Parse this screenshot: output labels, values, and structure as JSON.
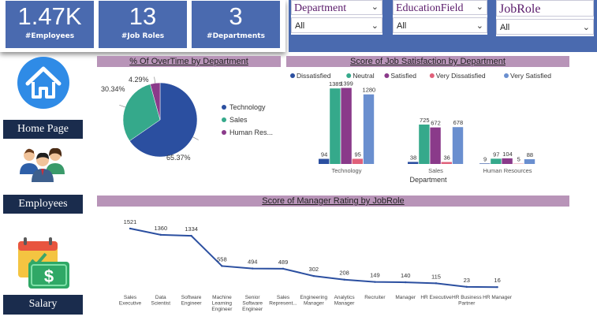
{
  "kpis": [
    {
      "value": "1.47K",
      "label": "#Employees"
    },
    {
      "value": "13",
      "label": "#Job Roles"
    },
    {
      "value": "3",
      "label": "#Departments"
    }
  ],
  "filters": [
    {
      "title": "Department",
      "value": "All"
    },
    {
      "title": "EducationField",
      "value": "All"
    },
    {
      "title": "JobRole",
      "value": "All"
    }
  ],
  "nav": {
    "home": "Home Page",
    "employees": "Employees",
    "salary": "Salary"
  },
  "colors": {
    "kpi_bg": "#4a6aaf",
    "nav_bg": "#1a2c4d",
    "title_bg": "#b894b8",
    "dissatisfied": "#2b4fa0",
    "neutral": "#35a98b",
    "satisfied": "#8a3a8a",
    "very_dissatisfied": "#e0607a",
    "very_satisfied": "#6a8fcf",
    "line": "#2b4fa0"
  },
  "charts": [
    {
      "title": "% Of OverTime by Department",
      "chart_data": {
        "type": "pie",
        "labels": [
          "Technology",
          "Sales",
          "Human Res..."
        ],
        "values": [
          65.37,
          30.34,
          4.29
        ],
        "data_labels": [
          "65.37%",
          "30.34%",
          "4.29%"
        ],
        "colors": [
          "#2b4fa0",
          "#35a98b",
          "#8a3a8a"
        ],
        "legend": "right"
      }
    },
    {
      "title": "Score of Job Satisfaction by Department",
      "chart_data": {
        "type": "bar",
        "xlabel": "Department",
        "categories": [
          "Technology",
          "Sales",
          "Human Resources"
        ],
        "series": [
          {
            "name": "Dissatisfied",
            "values": [
              94,
              38,
              9
            ],
            "color": "#2b4fa0"
          },
          {
            "name": "Neutral",
            "values": [
              1389,
              725,
              97
            ],
            "color": "#35a98b"
          },
          {
            "name": "Satisfied",
            "values": [
              1399,
              672,
              104
            ],
            "color": "#8a3a8a"
          },
          {
            "name": "Very Dissatisfied",
            "values": [
              95,
              36,
              5
            ],
            "color": "#e0607a"
          },
          {
            "name": "Very Satisfied",
            "values": [
              1280,
              678,
              88
            ],
            "color": "#6a8fcf"
          }
        ],
        "legend": "top",
        "ylim": [
          0,
          1450
        ]
      }
    },
    {
      "title": "Score of Manager Rating by JobRole",
      "chart_data": {
        "type": "line",
        "categories": [
          "Sales Executive",
          "Data Scientist",
          "Software Engineer",
          "Machine Learning Engineer",
          "Senior Software Engineer",
          "Sales Represent...",
          "Engineering Manager",
          "Analytics Manager",
          "Recruiter",
          "Manager",
          "HR Executive",
          "HR Business Partner",
          "HR Manager"
        ],
        "values": [
          1521,
          1360,
          1334,
          558,
          494,
          489,
          302,
          208,
          149,
          140,
          115,
          23,
          16
        ],
        "ylim": [
          0,
          1600
        ]
      }
    }
  ]
}
